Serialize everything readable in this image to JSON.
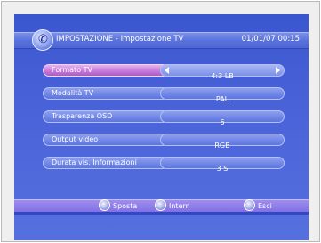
{
  "header": {
    "title": "IMPOSTAZIONE - Impostazione TV",
    "datetime": "01/01/07 00:15"
  },
  "settings": [
    {
      "label": "Formato TV",
      "value": "4:3 LB",
      "selected": true
    },
    {
      "label": "Modalità TV",
      "value": "PAL",
      "selected": false
    },
    {
      "label": "Trasparenza OSD",
      "value": "6",
      "selected": false
    },
    {
      "label": "Output video",
      "value": "RGB",
      "selected": false
    },
    {
      "label": "Durata vis. Informazioni",
      "value": "3 S",
      "selected": false
    }
  ],
  "footer": {
    "move_label": "Sposta",
    "confirm_label": "Interr.",
    "exit_label": "Esci"
  },
  "colors": {
    "background": "#4a62d8",
    "selected": "#c77ad9",
    "footer": "#7e6fe2"
  }
}
